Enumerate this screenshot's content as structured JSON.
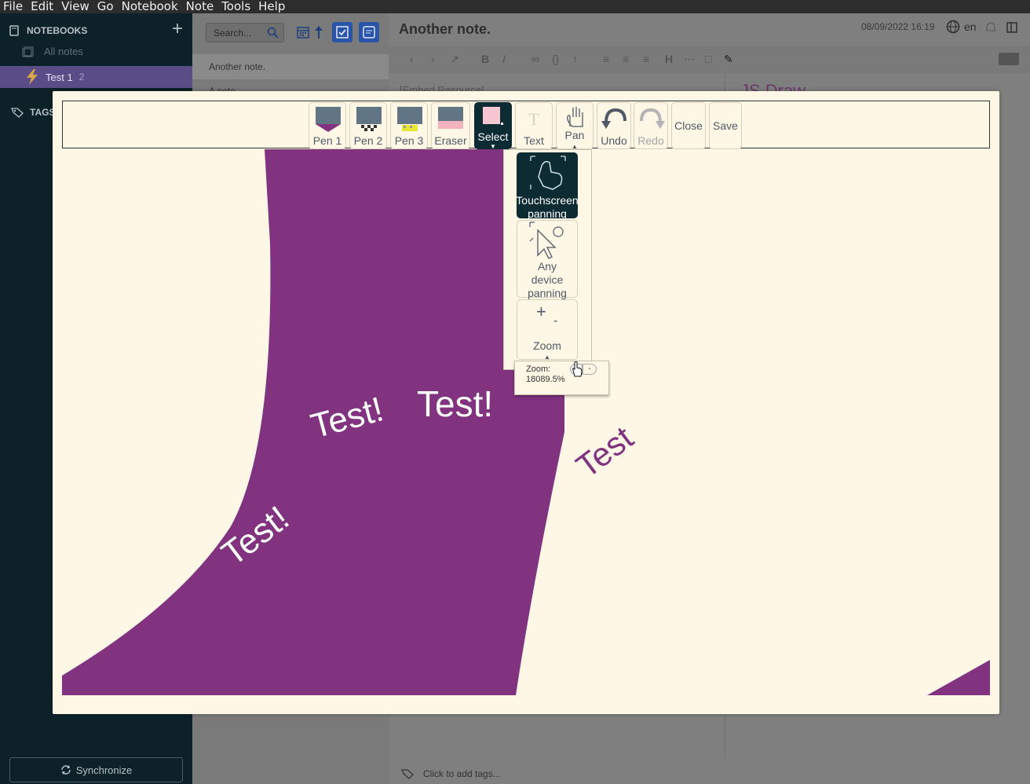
{
  "menubar": {
    "items": [
      "File",
      "Edit",
      "View",
      "Go",
      "Notebook",
      "Note",
      "Tools",
      "Help"
    ]
  },
  "sidebar": {
    "notebooks_title": "NOTEBOOKS",
    "all_notes": "All notes",
    "notebook": {
      "label": "Test 1",
      "count": "2"
    },
    "tags_title": "TAGS",
    "sync_label": "Synchronize"
  },
  "notelist": {
    "search_placeholder": "Search...",
    "notes": [
      "Another note.",
      "A note"
    ]
  },
  "editor": {
    "title": "Another note.",
    "date": "08/09/2022 16:19",
    "lang": "en",
    "ghost_left": "[Embed Resource]",
    "ghost_right": "JS Draw",
    "tags_placeholder": "Click to add tags..."
  },
  "jsdraw": {
    "tools": {
      "pen1": "Pen 1",
      "pen2": "Pen 2",
      "pen3": "Pen 3",
      "eraser": "Eraser",
      "select": "Select",
      "text": "Text",
      "pan": "Pan",
      "undo": "Undo",
      "redo": "Redo",
      "close": "Close",
      "save": "Save"
    },
    "pan_menu": {
      "touch_line1": "Touchscreen",
      "touch_line2": "panning",
      "any_line1": "Any",
      "any_line2": "device",
      "any_line3": "panning",
      "zoom": "Zoom"
    },
    "zoom_popup": {
      "label": "Zoom:",
      "value": "18089.5%",
      "minus": "-"
    },
    "canvas_texts": [
      "Test!",
      "Test!",
      "Test!",
      "Test"
    ]
  },
  "colors": {
    "sidebar_bg": "#0d2128",
    "notebook_highlight": "#5a4d87",
    "dialog_bg": "#fef7e6",
    "stroke_purple": "#813380",
    "selected_tool": "#0d2b33"
  }
}
